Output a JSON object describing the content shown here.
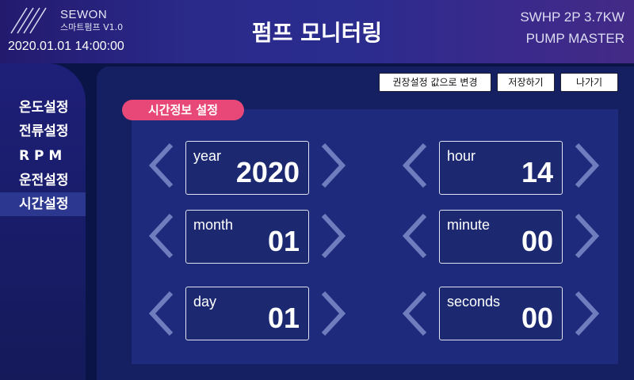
{
  "header": {
    "brand": "SEWON",
    "subtitle": "스마트펌프 V1.0",
    "datetime": "2020.01.01 14:00:00",
    "title": "펌프 모니터링",
    "model_line1": "SWHP  2P 3.7KW",
    "model_line2": "PUMP MASTER"
  },
  "sidebar": {
    "items": [
      {
        "label": "온도설정",
        "active": false
      },
      {
        "label": "전류설정",
        "active": false
      },
      {
        "label": "R P M",
        "active": false
      },
      {
        "label": "운전설정",
        "active": false
      },
      {
        "label": "시간설정",
        "active": true
      }
    ]
  },
  "toolbar": {
    "reset_label": "권장설정 값으로 변경",
    "save_label": "저장하기",
    "exit_label": "나가기"
  },
  "section": {
    "title": "시간정보 설정"
  },
  "fields": {
    "year": {
      "label": "year",
      "value": "2020"
    },
    "month": {
      "label": "month",
      "value": "01"
    },
    "day": {
      "label": "day",
      "value": "01"
    },
    "hour": {
      "label": "hour",
      "value": "14"
    },
    "minute": {
      "label": "minute",
      "value": "00"
    },
    "seconds": {
      "label": "seconds",
      "value": "00"
    }
  },
  "colors": {
    "background": "#0a1446",
    "accent_pink": "#e84878",
    "arrow": "#6f7dbf"
  }
}
